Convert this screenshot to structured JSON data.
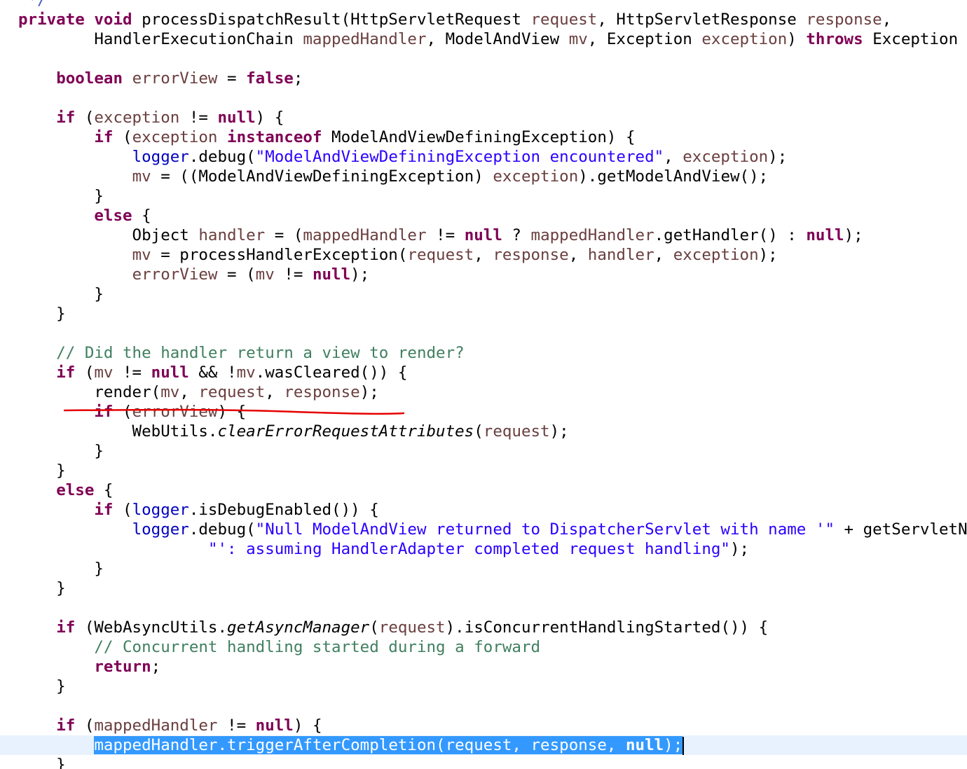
{
  "editor": {
    "lines": [
      " */",
      "private void processDispatchResult(HttpServletRequest request, HttpServletResponse response,",
      "        HandlerExecutionChain mappedHandler, ModelAndView mv, Exception exception) throws Exception {",
      "",
      "    boolean errorView = false;",
      "",
      "    if (exception != null) {",
      "        if (exception instanceof ModelAndViewDefiningException) {",
      "            logger.debug(\"ModelAndViewDefiningException encountered\", exception);",
      "            mv = ((ModelAndViewDefiningException) exception).getModelAndView();",
      "        }",
      "        else {",
      "            Object handler = (mappedHandler != null ? mappedHandler.getHandler() : null);",
      "            mv = processHandlerException(request, response, handler, exception);",
      "            errorView = (mv != null);",
      "        }",
      "    }",
      "",
      "    // Did the handler return a view to render?",
      "    if (mv != null && !mv.wasCleared()) {",
      "        render(mv, request, response);",
      "        if (errorView) {",
      "            WebUtils.clearErrorRequestAttributes(request);",
      "        }",
      "    }",
      "    else {",
      "        if (logger.isDebugEnabled()) {",
      "            logger.debug(\"Null ModelAndView returned to DispatcherServlet with name '\" + getServletName(",
      "                    \"': assuming HandlerAdapter completed request handling\");",
      "        }",
      "    }",
      "",
      "    if (WebAsyncUtils.getAsyncManager(request).isConcurrentHandlingStarted()) {",
      "        // Concurrent handling started during a forward",
      "        return;",
      "    }",
      "",
      "    if (mappedHandler != null) {",
      "        mappedHandler.triggerAfterCompletion(request, response, null);",
      "    }"
    ],
    "selected_text": "mappedHandler.triggerAfterCompletion(request, response, null);",
    "underlined_text": "render(mv, request, response);",
    "colors": {
      "keyword": "#7f0055",
      "local_variable": "#6a3e3e",
      "field": "#0000c0",
      "string": "#2a00ff",
      "comment": "#3f7f5f",
      "selection": "#3399ff",
      "current_line": "#e8f2fe",
      "annotation": "#e60000"
    }
  }
}
